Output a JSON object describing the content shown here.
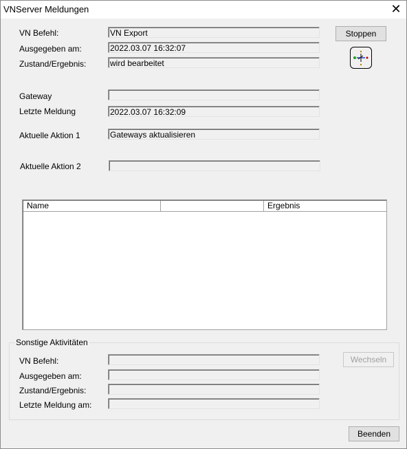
{
  "window": {
    "title": "VNServer Meldungen"
  },
  "main": {
    "vn_befehl_label": "VN Befehl:",
    "vn_befehl_value": "VN Export",
    "ausgegeben_label": "Ausgegeben am:",
    "ausgegeben_value": "2022.03.07 16:32:07",
    "zustand_label": "Zustand/Ergebnis:",
    "zustand_value": "wird bearbeitet",
    "gateway_label": "Gateway",
    "gateway_value": "",
    "letzte_label": "Letzte Meldung",
    "letzte_value": "2022.03.07 16:32:09",
    "aktion1_label": "Aktuelle Aktion 1",
    "aktion1_value": "Gateways aktualisieren",
    "aktion2_label": "Aktuelle Aktion 2",
    "aktion2_value": ""
  },
  "buttons": {
    "stoppen": "Stoppen",
    "wechseln": "Wechseln",
    "beenden": "Beenden"
  },
  "table": {
    "columns": [
      "Name",
      "",
      "Ergebnis"
    ],
    "rows": []
  },
  "sonstige": {
    "title": "Sonstige Aktivitäten",
    "vn_befehl_label": "VN Befehl:",
    "vn_befehl_value": "",
    "ausgegeben_label": "Ausgegeben am:",
    "ausgegeben_value": "",
    "zustand_label": "Zustand/Ergebnis:",
    "zustand_value": "",
    "letzte_label": "Letzte Meldung am:",
    "letzte_value": ""
  },
  "icons": {
    "close": "close-icon",
    "status": "network-status-icon"
  }
}
